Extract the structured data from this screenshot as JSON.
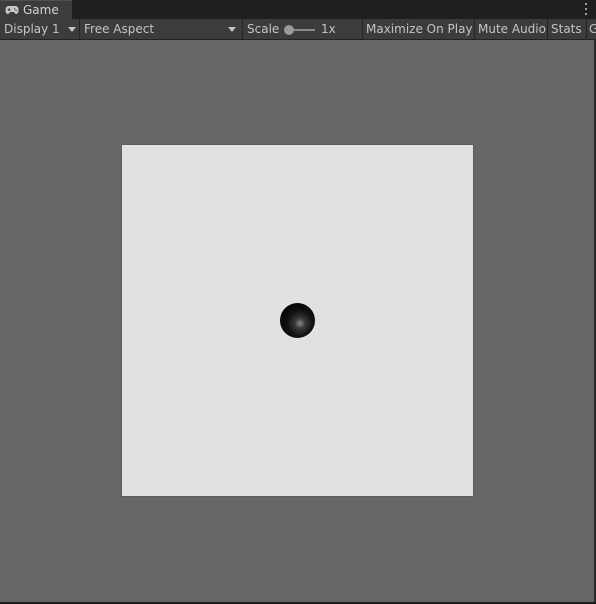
{
  "window": {
    "tab_label": "Game",
    "tab_icon": "gamepad-icon"
  },
  "toolbar": {
    "display_label": "Display 1",
    "aspect_label": "Free Aspect",
    "scale_label": "Scale",
    "scale_value": "1x",
    "scale_slider_fraction": 0.0,
    "maximize_label": "Maximize On Play",
    "mute_label": "Mute Audio",
    "stats_label": "Stats",
    "gizmos_label": "G"
  },
  "colors": {
    "toolbar_bg": "#3c3c3c",
    "viewport_bg": "#676767",
    "game_bg": "#e1e1e1",
    "sphere": "#000000"
  }
}
